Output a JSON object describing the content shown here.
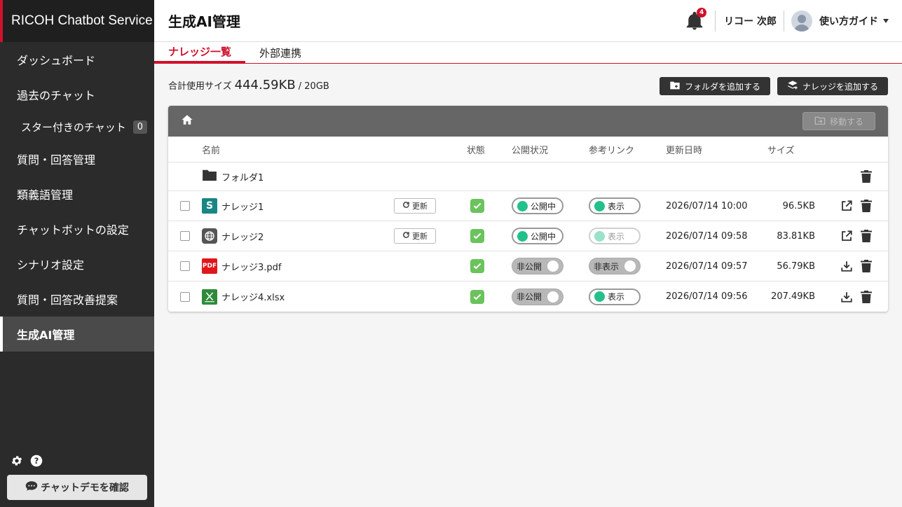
{
  "brand": "RICOH Chatbot Service",
  "sidebar": {
    "items": [
      {
        "label": "ダッシュボード"
      },
      {
        "label": "過去のチャット"
      },
      {
        "label": "スター付きのチャット",
        "count": "0"
      },
      {
        "label": "質問・回答管理"
      },
      {
        "label": "類義語管理"
      },
      {
        "label": "チャットボットの設定"
      },
      {
        "label": "シナリオ設定"
      },
      {
        "label": "質問・回答改善提案"
      },
      {
        "label": "生成AI管理"
      }
    ],
    "demo_button": "チャットデモを確認"
  },
  "header": {
    "title": "生成AI管理",
    "notification_count": "4",
    "user_name": "リコー 次郎",
    "guide": "使い方ガイド"
  },
  "tabs": [
    {
      "label": "ナレッジ一覧"
    },
    {
      "label": "外部連携"
    }
  ],
  "usage": {
    "label": "合計使用サイズ",
    "value": "444.59KB",
    "limit": "/ 20GB"
  },
  "actions": {
    "add_folder": "フォルダを追加する",
    "add_knowledge": "ナレッジを追加する",
    "move": "移動する"
  },
  "table": {
    "columns": {
      "name": "名前",
      "status": "状態",
      "public": "公開状況",
      "link": "参考リンク",
      "updated": "更新日時",
      "size": "サイズ"
    },
    "update_label": "更新",
    "folder": {
      "name": "フォルダ1"
    },
    "rows": [
      {
        "name": "ナレッジ1",
        "icon": "sharepoint-icon",
        "public": "公開中",
        "link": "表示",
        "updated": "2026/07/14 10:00",
        "size": "96.5KB"
      },
      {
        "name": "ナレッジ2",
        "icon": "web-icon",
        "public": "公開中",
        "link": "表示",
        "updated": "2026/07/14 09:58",
        "size": "83.81KB"
      },
      {
        "name": "ナレッジ3.pdf",
        "icon": "pdf-icon",
        "icon_text": "PDF",
        "public": "非公開",
        "link": "非表示",
        "updated": "2026/07/14 09:57",
        "size": "56.79KB"
      },
      {
        "name": "ナレッジ4.xlsx",
        "icon": "excel-icon",
        "public": "非公開",
        "link": "表示",
        "updated": "2026/07/14 09:56",
        "size": "207.49KB"
      }
    ]
  },
  "colors": {
    "accent": "#d0112b",
    "toggle_on": "#23c08c",
    "status_ok": "#6ac35c"
  }
}
